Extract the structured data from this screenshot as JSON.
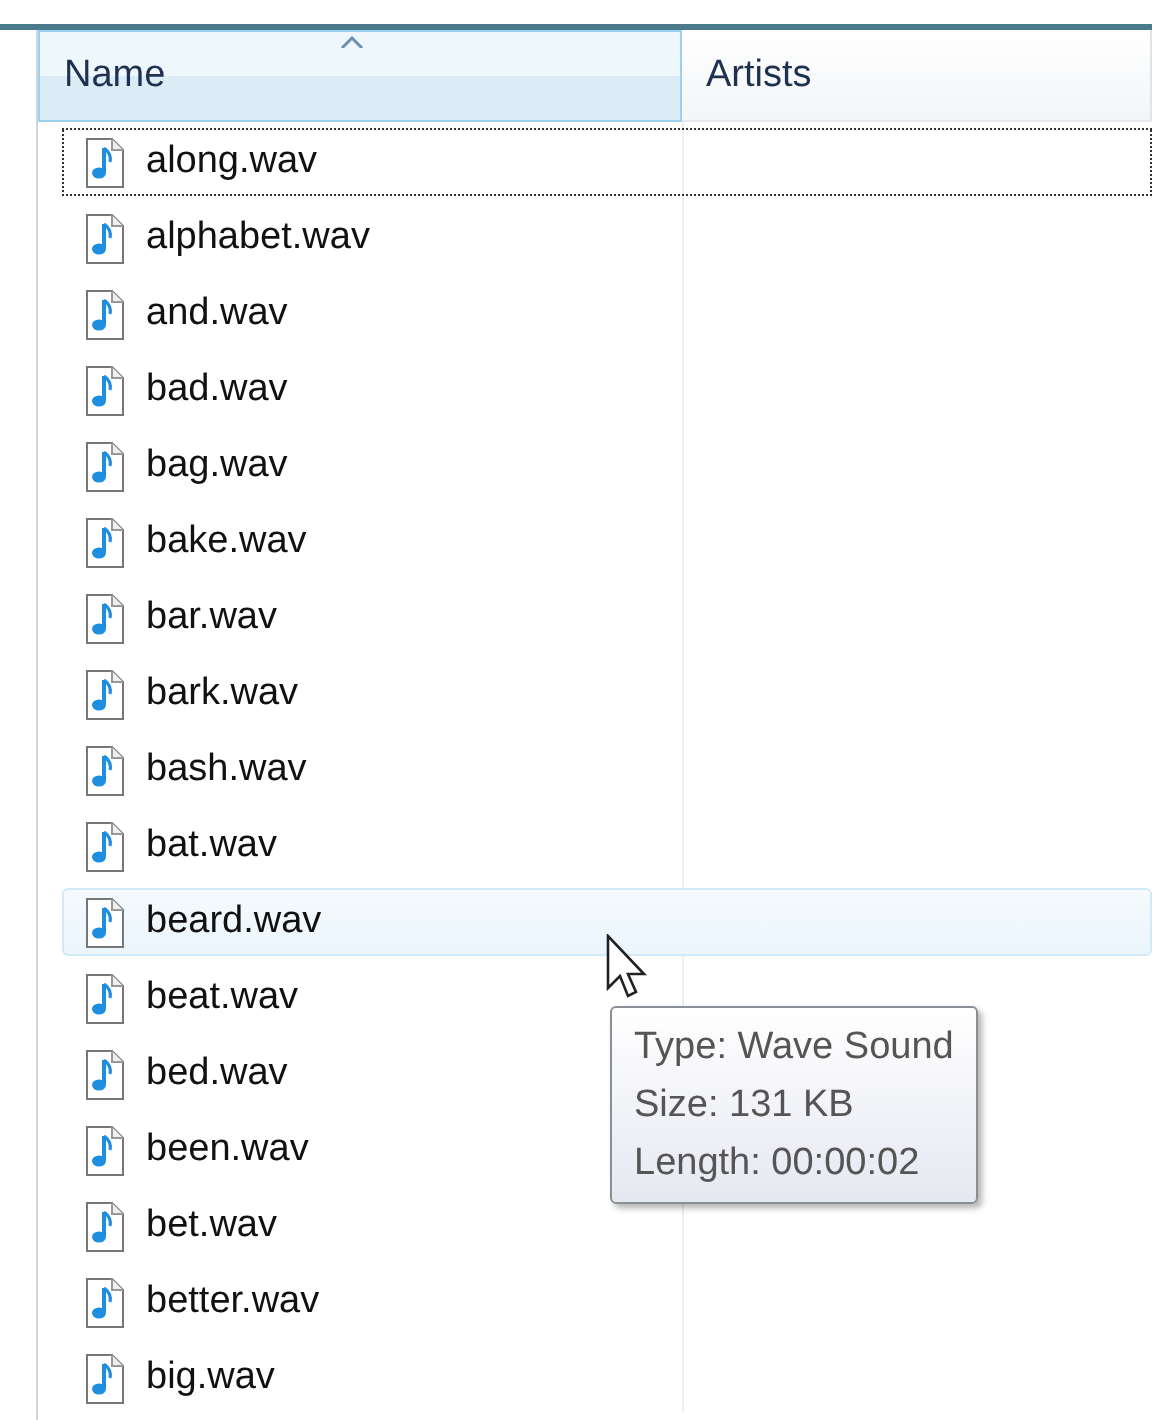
{
  "columns": [
    {
      "label": "Name",
      "sorted": true
    },
    {
      "label": "Artists",
      "sorted": false
    }
  ],
  "files": [
    {
      "name": "along.wav",
      "focused": true,
      "hovered": false
    },
    {
      "name": "alphabet.wav",
      "focused": false,
      "hovered": false
    },
    {
      "name": "and.wav",
      "focused": false,
      "hovered": false
    },
    {
      "name": "bad.wav",
      "focused": false,
      "hovered": false
    },
    {
      "name": "bag.wav",
      "focused": false,
      "hovered": false
    },
    {
      "name": "bake.wav",
      "focused": false,
      "hovered": false
    },
    {
      "name": "bar.wav",
      "focused": false,
      "hovered": false
    },
    {
      "name": "bark.wav",
      "focused": false,
      "hovered": false
    },
    {
      "name": "bash.wav",
      "focused": false,
      "hovered": false
    },
    {
      "name": "bat.wav",
      "focused": false,
      "hovered": false
    },
    {
      "name": "beard.wav",
      "focused": false,
      "hovered": true
    },
    {
      "name": "beat.wav",
      "focused": false,
      "hovered": false
    },
    {
      "name": "bed.wav",
      "focused": false,
      "hovered": false
    },
    {
      "name": "been.wav",
      "focused": false,
      "hovered": false
    },
    {
      "name": "bet.wav",
      "focused": false,
      "hovered": false
    },
    {
      "name": "better.wav",
      "focused": false,
      "hovered": false
    },
    {
      "name": "big.wav",
      "focused": false,
      "hovered": false
    }
  ],
  "tooltip": {
    "lines": [
      "Type: Wave Sound",
      "Size: 131 KB",
      "Length: 00:00:02"
    ]
  }
}
